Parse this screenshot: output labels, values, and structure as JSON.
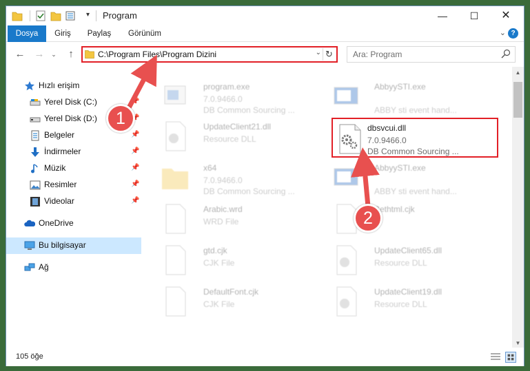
{
  "window": {
    "title": "Program"
  },
  "ribbon": {
    "tabs": [
      {
        "label": "Dosya"
      },
      {
        "label": "Giriş"
      },
      {
        "label": "Paylaş"
      },
      {
        "label": "Görünüm"
      }
    ]
  },
  "navigation": {
    "address": "C:\\Program Files\\Program Dizini",
    "search_placeholder": "Ara: Program"
  },
  "sidebar": {
    "items": [
      {
        "label": "Hızlı erişim",
        "icon": "star-icon"
      },
      {
        "label": "Yerel Disk (C:)",
        "icon": "drive-icon",
        "pinned": true
      },
      {
        "label": "Yerel Disk (D:)",
        "icon": "drive-icon",
        "pinned": true
      },
      {
        "label": "Belgeler",
        "icon": "documents-icon",
        "pinned": true
      },
      {
        "label": "İndirmeler",
        "icon": "download-icon",
        "pinned": true
      },
      {
        "label": "Müzik",
        "icon": "music-icon",
        "pinned": true
      },
      {
        "label": "Resimler",
        "icon": "pictures-icon",
        "pinned": true
      },
      {
        "label": "Videolar",
        "icon": "video-icon",
        "pinned": true
      },
      {
        "label": "OneDrive",
        "icon": "cloud-icon"
      },
      {
        "label": "Bu bilgisayar",
        "icon": "computer-icon",
        "selected": true
      },
      {
        "label": "Ağ",
        "icon": "network-icon"
      }
    ]
  },
  "files": [
    {
      "name": "program.exe",
      "line1": "7.0.9466.0",
      "line2": "DB Common Sourcing ...",
      "icon": "exe-icon",
      "faded": true
    },
    {
      "name": "AbbyySTI.exe",
      "line1": "",
      "line2": "ABBY sti event hand...",
      "icon": "exe-icon",
      "faded": true
    },
    {
      "name": "UpdateClient21.dll",
      "line1": "Resource DLL",
      "line2": "",
      "icon": "dll-icon",
      "faded": true
    },
    {
      "name": "dbsvcui.dll",
      "line1": "7.0.9466.0",
      "line2": "DB Common Sourcing ...",
      "icon": "dll-icon",
      "faded": false,
      "highlighted": true
    },
    {
      "name": "x64",
      "line1": "7.0.9466.0",
      "line2": "DB Common Sourcing ...",
      "icon": "folder-icon",
      "faded": true
    },
    {
      "name": "AbbyySTI.exe",
      "line1": "",
      "line2": "ABBY sti event hand...",
      "icon": "exe-icon",
      "faded": true
    },
    {
      "name": "Arabic.wrd",
      "line1": "WRD File",
      "line2": "",
      "icon": "file-icon",
      "faded": true
    },
    {
      "name": "Bethtml.cjk",
      "line1": "",
      "line2": "",
      "icon": "file-icon",
      "faded": true
    },
    {
      "name": "gtd.cjk",
      "line1": "CJK File",
      "line2": "",
      "icon": "file-icon",
      "faded": true
    },
    {
      "name": "UpdateClient65.dll",
      "line1": "Resource DLL",
      "line2": "",
      "icon": "dll-icon",
      "faded": true
    },
    {
      "name": "DefaultFont.cjk",
      "line1": "CJK File",
      "line2": "",
      "icon": "file-icon",
      "faded": true
    },
    {
      "name": "UpdateClient19.dll",
      "line1": "Resource DLL",
      "line2": "",
      "icon": "dll-icon",
      "faded": true
    }
  ],
  "status": {
    "count": "105 öğe"
  },
  "callouts": [
    {
      "number": "1"
    },
    {
      "number": "2"
    }
  ],
  "colors": {
    "accent": "#1979ca",
    "highlight": "#e21f26",
    "badge": "#e8504f",
    "selection": "#cce8ff"
  }
}
